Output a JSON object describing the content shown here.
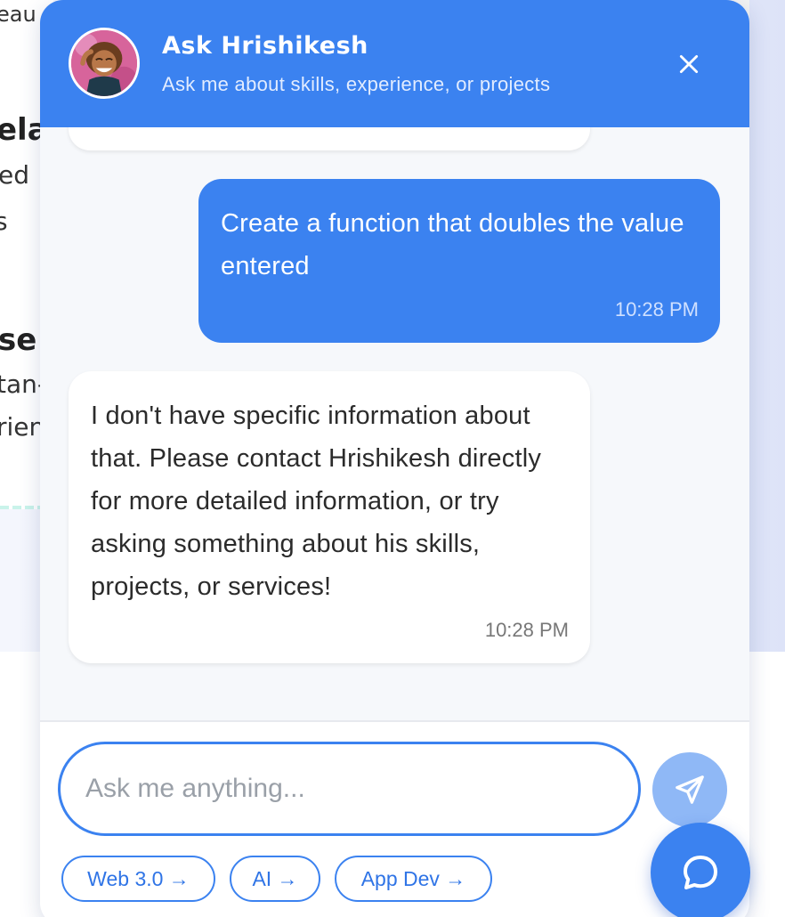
{
  "background_page": {
    "fragments": [
      "eau",
      "ela",
      "ed",
      "s",
      "se",
      "tan-",
      "rien"
    ]
  },
  "chat": {
    "header": {
      "title": "Ask Hrishikesh",
      "subtitle": "Ask me about skills, experience, or projects",
      "close_icon": "close-icon"
    },
    "messages": [
      {
        "sender": "user",
        "text": "Create a function that doubles the value entered",
        "time": "10:28 PM"
      },
      {
        "sender": "bot",
        "text": "I don't have specific information about that. Please contact Hrishikesh directly for more detailed information, or try asking something about his skills, projects, or services!",
        "time": "10:28 PM"
      }
    ],
    "input": {
      "value": "",
      "placeholder": "Ask me anything..."
    },
    "quick_chips": [
      {
        "label": "Web 3.0 →"
      },
      {
        "label": "AI →"
      },
      {
        "label": "App Dev →"
      }
    ],
    "send_icon": "send-icon",
    "launcher_icon": "chat-bubble-icon"
  },
  "colors": {
    "accent": "#3b82f0",
    "send_button": "#8fb8f6",
    "panel_bg": "#f6f8fb",
    "bot_text": "#2b2b2b"
  }
}
